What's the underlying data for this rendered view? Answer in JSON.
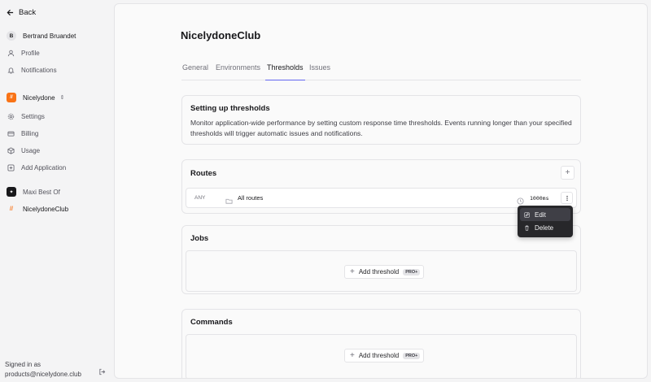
{
  "sidebar": {
    "back_label": "Back",
    "user": {
      "initial": "B",
      "name": "Bertrand Bruandet"
    },
    "account_items": [
      {
        "label": "Profile",
        "icon": "user-icon"
      },
      {
        "label": "Notifications",
        "icon": "bell-icon"
      }
    ],
    "org": {
      "name": "Nicelydone",
      "logo_text": "//"
    },
    "org_items": [
      {
        "label": "Settings",
        "icon": "gear-icon"
      },
      {
        "label": "Billing",
        "icon": "card-icon"
      },
      {
        "label": "Usage",
        "icon": "package-icon"
      },
      {
        "label": "Add Application",
        "icon": "plus-icon"
      }
    ],
    "apps": [
      {
        "name": "Maxi Best Of",
        "logo_text": "✦"
      },
      {
        "name": "NicelydoneClub",
        "logo_text": "//"
      }
    ],
    "signed_in_label": "Signed in as",
    "signed_in_email": "products@nicelydone.club"
  },
  "main": {
    "title": "NicelydoneClub",
    "tabs": [
      {
        "label": "General",
        "active": false
      },
      {
        "label": "Environments",
        "active": false
      },
      {
        "label": "Thresholds",
        "active": true
      },
      {
        "label": "Issues",
        "active": false
      }
    ],
    "intro": {
      "title": "Setting up thresholds",
      "text": "Monitor application-wide performance by setting custom response time thresholds. Events running longer than your specified thresholds will trigger automatic issues and notifications."
    },
    "routes": {
      "title": "Routes",
      "rows": [
        {
          "method": "ANY",
          "name": "All routes",
          "threshold": "1000ms"
        }
      ]
    },
    "jobs": {
      "title": "Jobs",
      "add_label": "Add threshold",
      "badge": "PRO+"
    },
    "commands": {
      "title": "Commands",
      "add_label": "Add threshold",
      "badge": "PRO+"
    }
  },
  "context_menu": {
    "items": [
      {
        "label": "Edit",
        "icon": "edit-icon"
      },
      {
        "label": "Delete",
        "icon": "trash-icon"
      }
    ]
  },
  "colors": {
    "accent": "#6366f1",
    "brand_orange": "#f97316",
    "menu_bg": "#27272a"
  }
}
